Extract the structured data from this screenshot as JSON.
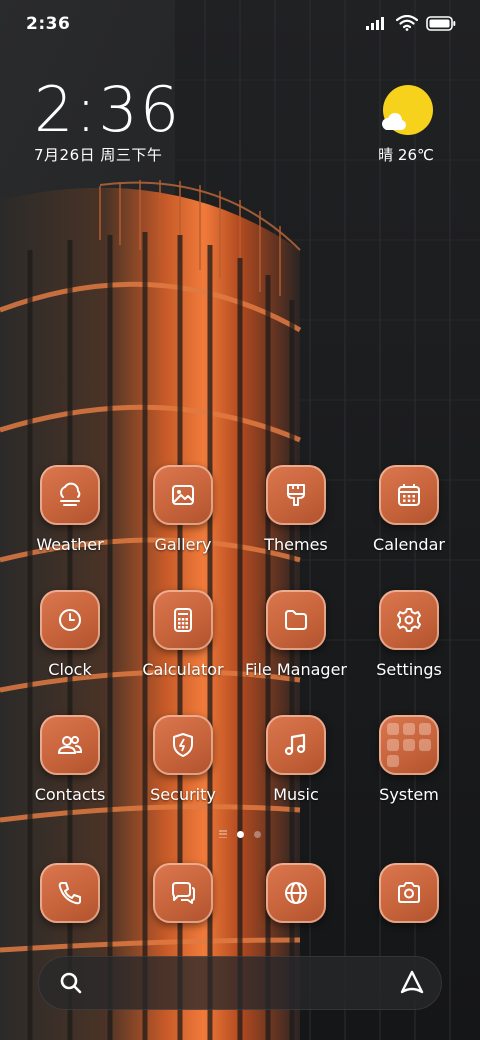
{
  "status_bar": {
    "time": "2:36"
  },
  "clock_widget": {
    "time": "2:36",
    "date": "7月26日 周三下午"
  },
  "weather_widget": {
    "condition": "晴",
    "temperature": "26℃",
    "label": "晴 26℃",
    "icon": "sun-cloud-icon"
  },
  "apps": [
    {
      "label": "Weather",
      "icon": "weather-icon"
    },
    {
      "label": "Gallery",
      "icon": "gallery-icon"
    },
    {
      "label": "Themes",
      "icon": "themes-brush-icon"
    },
    {
      "label": "Calendar",
      "icon": "calendar-icon"
    },
    {
      "label": "Clock",
      "icon": "clock-icon"
    },
    {
      "label": "Calculator",
      "icon": "calculator-icon"
    },
    {
      "label": "File Manager",
      "icon": "folder-icon"
    },
    {
      "label": "Settings",
      "icon": "gear-icon"
    },
    {
      "label": "Contacts",
      "icon": "contacts-icon"
    },
    {
      "label": "Security",
      "icon": "shield-icon"
    },
    {
      "label": "Music",
      "icon": "music-note-icon"
    },
    {
      "label": "System",
      "icon": "folder-grid-icon"
    }
  ],
  "dock": [
    {
      "icon": "phone-icon"
    },
    {
      "icon": "messages-icon"
    },
    {
      "icon": "browser-globe-icon"
    },
    {
      "icon": "camera-icon"
    }
  ],
  "page_indicator": {
    "pages": 3,
    "active": 1
  },
  "colors": {
    "tile_orange": "#c9653d",
    "sun_yellow": "#f7d21c",
    "background": "#1c1d1f"
  }
}
